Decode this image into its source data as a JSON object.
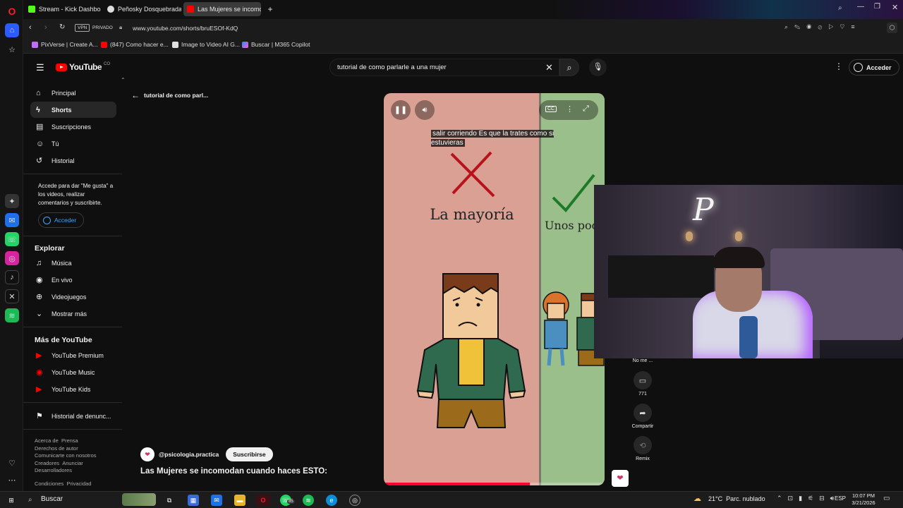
{
  "browser": {
    "tabs": [
      {
        "label": "Stream - Kick Dashboard",
        "favicon_color": "#53fc18"
      },
      {
        "label": "Peñosky Dosquebradas, P",
        "favicon_color": "#dddddd"
      },
      {
        "label": "Las Mujeres se incomo",
        "favicon_color": "#ff0000"
      }
    ],
    "new_tab": "+",
    "url": "www.youtube.com/shorts/bruESOf-KdQ",
    "vpn": "VPN",
    "private": "PRIVADO",
    "bookmarks": [
      "PixVerse | Create A...",
      "(847) Como hacer e...",
      "Image to Video AI G...",
      "Buscar | M365 Copilot"
    ]
  },
  "youtube": {
    "logo": "YouTube",
    "logo_region": "CO",
    "search_query": "tutorial de como parlarle a una mujer",
    "signin": "Acceder",
    "back_title": "tutorial de como parl...",
    "nav_main": [
      {
        "label": "Principal",
        "icon": "home-icon"
      },
      {
        "label": "Shorts",
        "icon": "shorts-icon"
      },
      {
        "label": "Suscripciones",
        "icon": "subscriptions-icon"
      },
      {
        "label": "Tú",
        "icon": "user-icon"
      },
      {
        "label": "Historial",
        "icon": "history-icon"
      }
    ],
    "signin_prompt": "Accede para dar \"Me gusta\" a los videos, realizar comentarios y suscribirte.",
    "signin_button": "Acceder",
    "explore_title": "Explorar",
    "explore": [
      {
        "label": "Música",
        "icon": "music-icon"
      },
      {
        "label": "En vivo",
        "icon": "live-icon"
      },
      {
        "label": "Videojuegos",
        "icon": "gaming-icon"
      },
      {
        "label": "Mostrar más",
        "icon": "chevron-down-icon"
      }
    ],
    "more_title": "Más de YouTube",
    "more": [
      {
        "label": "YouTube Premium"
      },
      {
        "label": "YouTube Music"
      },
      {
        "label": "YouTube Kids"
      }
    ],
    "report_history": "Historial de denunc...",
    "footer_1": [
      "Acerca de",
      "Prensa"
    ],
    "footer_2": [
      "Derechos de autor"
    ],
    "footer_3": [
      "Comunicarte con nosotros"
    ],
    "footer_4": [
      "Creadores",
      "Anunciar"
    ],
    "footer_5": [
      "Desarrolladores"
    ],
    "footer_6": [
      "Condiciones",
      "Privacidad"
    ],
    "short": {
      "caption": "salir corriendo Es que la trates como si estuvieras",
      "left_label": "La mayoría",
      "right_label": "Unos pocos",
      "channel": "@psicologia.practica",
      "subscribe": "Suscribirse",
      "title": "Las Mujeres se incomodan cuando haces ESTO:",
      "progress": 0.66
    },
    "actions": {
      "dislike_label": "No me ...",
      "comments_count": "771",
      "share_label": "Compartir",
      "remix_label": "Remix"
    }
  },
  "taskbar": {
    "search": "Buscar",
    "weather": "21°C  Parc. nublado",
    "lang": "ESP",
    "time": "10:07 PM",
    "date": "3/21/2026",
    "whatsapp_badge": "85"
  }
}
